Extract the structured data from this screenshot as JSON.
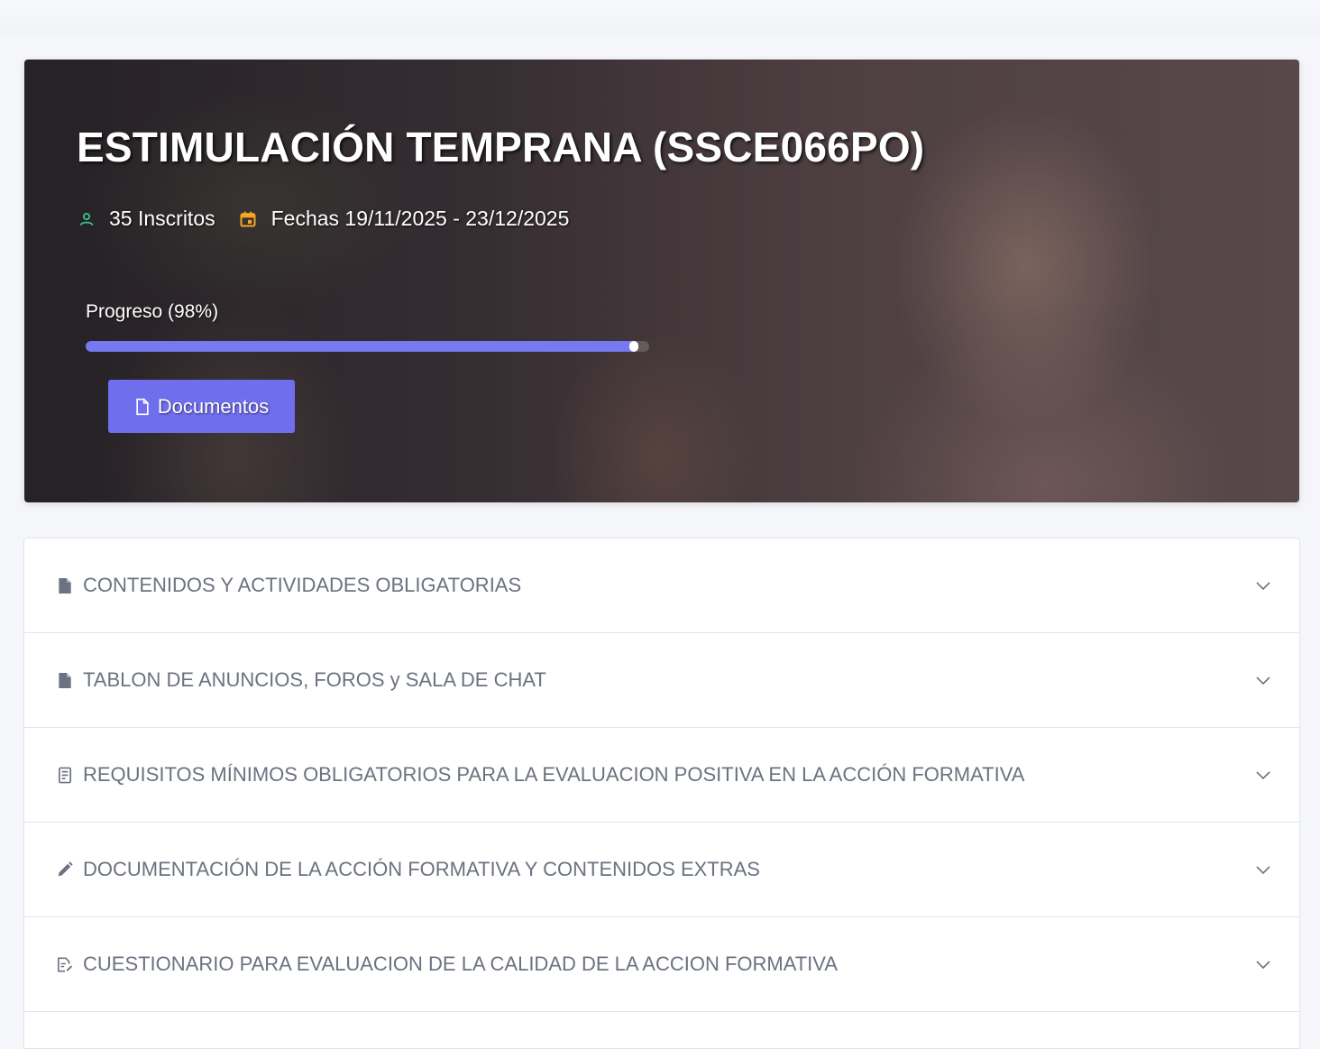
{
  "course": {
    "title": "ESTIMULACIÓN TEMPRANA (SSCE066PO)",
    "enrolled": "35 Inscritos",
    "dates": "Fechas 19/11/2025 - 23/12/2025",
    "progress_label": "Progreso (98%)",
    "progress_value": 98,
    "documents_button": "Documentos"
  },
  "colors": {
    "accent": "#6f6fee",
    "progress": "#7779f0",
    "user_icon": "#35c68f",
    "calendar_icon": "#f5a623",
    "section_text": "#6b7280"
  },
  "sections": [
    {
      "label": "CONTENIDOS Y ACTIVIDADES OBLIGATORIAS",
      "icon": "file-icon"
    },
    {
      "label": "TABLON DE ANUNCIOS, FOROS y SALA DE CHAT",
      "icon": "file-icon"
    },
    {
      "label": "REQUISITOS MÍNIMOS OBLIGATORIOS PARA LA EVALUACION POSITIVA EN LA ACCIÓN FORMATIVA",
      "icon": "checklist-icon"
    },
    {
      "label": "DOCUMENTACIÓN DE LA ACCIÓN FORMATIVA Y CONTENIDOS EXTRAS",
      "icon": "pencil-icon"
    },
    {
      "label": "CUESTIONARIO PARA EVALUACION DE LA CALIDAD DE LA ACCION FORMATIVA",
      "icon": "edit-document-icon"
    }
  ]
}
